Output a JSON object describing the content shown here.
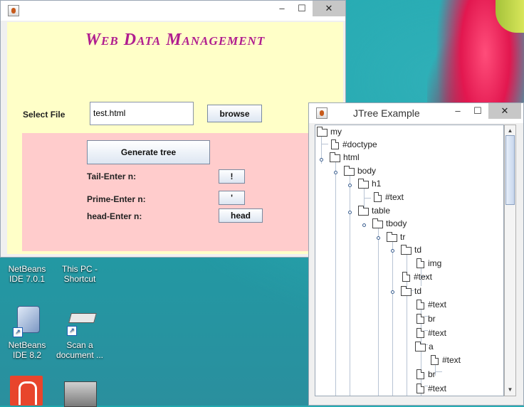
{
  "main_window": {
    "app_title": "Web Data Management",
    "select_file_label": "Select File",
    "file_value": "test.html",
    "browse_button": "browse",
    "generate_button": "Generate tree",
    "tail_label": "Tail-Enter n:",
    "tail_button": "!",
    "prime_label": "Prime-Enter n:",
    "prime_button": "'",
    "head_label": "head-Enter n:",
    "head_button": "head",
    "minimize": "–",
    "maximize": "☐",
    "close": "✕"
  },
  "tree_window": {
    "title": "JTree Example",
    "minimize": "–",
    "maximize": "☐",
    "close": "✕",
    "nodes": [
      {
        "label": "my",
        "type": "folder"
      },
      {
        "label": "#doctype",
        "type": "leaf"
      },
      {
        "label": "html",
        "type": "folder"
      },
      {
        "label": "body",
        "type": "folder"
      },
      {
        "label": "h1",
        "type": "folder"
      },
      {
        "label": "#text",
        "type": "leaf"
      },
      {
        "label": "table",
        "type": "folder"
      },
      {
        "label": "tbody",
        "type": "folder"
      },
      {
        "label": "tr",
        "type": "folder"
      },
      {
        "label": "td",
        "type": "folder"
      },
      {
        "label": "img",
        "type": "leaf"
      },
      {
        "label": "#text",
        "type": "leaf"
      },
      {
        "label": "td",
        "type": "folder"
      },
      {
        "label": "#text",
        "type": "leaf"
      },
      {
        "label": "br",
        "type": "leaf"
      },
      {
        "label": "#text",
        "type": "leaf"
      },
      {
        "label": "a",
        "type": "folder"
      },
      {
        "label": "#text",
        "type": "leaf"
      },
      {
        "label": "br",
        "type": "leaf"
      },
      {
        "label": "#text",
        "type": "leaf"
      }
    ]
  },
  "desktop": {
    "icons": [
      {
        "label": "NetBeans IDE 7.0.1"
      },
      {
        "label": "This PC - Shortcut"
      },
      {
        "label": "NetBeans IDE 8.2"
      },
      {
        "label": "Scan a document ..."
      }
    ]
  }
}
